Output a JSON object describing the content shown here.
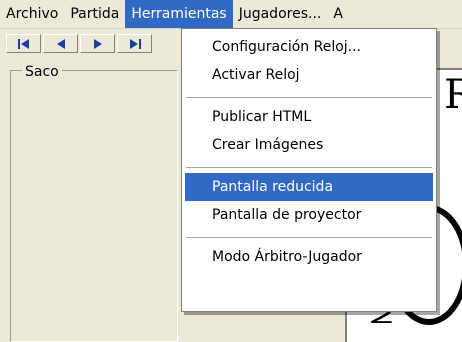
{
  "menubar": {
    "items": [
      {
        "label": "Archivo"
      },
      {
        "label": "Partida"
      },
      {
        "label": "Herramientas"
      },
      {
        "label": "Jugadores..."
      },
      {
        "label": "A"
      }
    ]
  },
  "left_panel": {
    "title": "Saco"
  },
  "right_panel": {
    "letter": "R",
    "mark": "2"
  },
  "dropdown": {
    "items": [
      {
        "label": "Configuración Reloj..."
      },
      {
        "label": "Activar Reloj"
      },
      {
        "label": "Publicar HTML"
      },
      {
        "label": "Crear Imágenes"
      },
      {
        "label": "Pantalla reducida"
      },
      {
        "label": "Pantalla de proyector"
      },
      {
        "label": "Modo Árbitro-Jugador"
      }
    ],
    "highlighted_index": 4
  },
  "colors": {
    "selection": "#316ac5",
    "face": "#ece9d8"
  }
}
